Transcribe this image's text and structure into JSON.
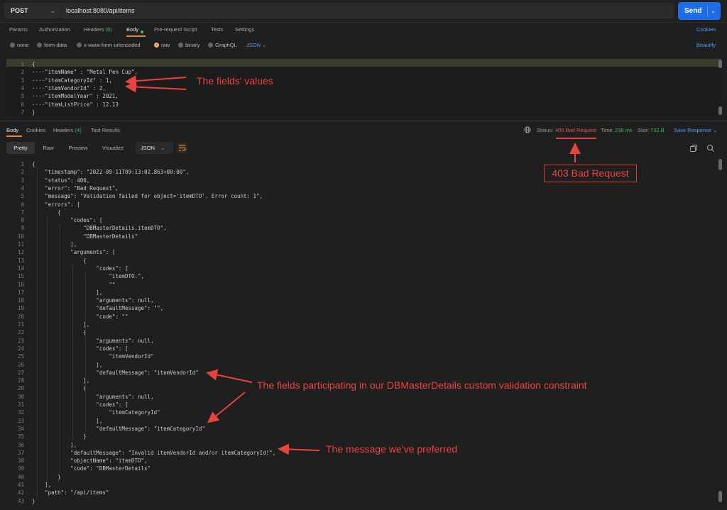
{
  "request": {
    "method": "POST",
    "url": "localhost:8080/api/items",
    "send_label": "Send"
  },
  "request_tabs": {
    "params": "Params",
    "authorization": "Authorization",
    "headers": "Headers",
    "headers_count": "(8)",
    "body": "Body",
    "prerequest": "Pre-request Script",
    "tests": "Tests",
    "settings": "Settings",
    "cookies": "Cookies"
  },
  "body_types": {
    "none": "none",
    "form_data": "form-data",
    "urlencoded": "x-www-form-urlencoded",
    "raw": "raw",
    "binary": "binary",
    "graphql": "GraphQL",
    "lang": "JSON",
    "beautify": "Beautify"
  },
  "request_body": {
    "line_numbers": [
      "1",
      "2",
      "3",
      "4",
      "5",
      "6",
      "7"
    ],
    "lines": [
      "{",
      "····\"itemName\" : \"Metal Pen Cup\",",
      "····\"itemCategoryId\" : 1,",
      "····\"itemVendorId\" : 2,",
      "····\"itemModelYear\" : 2021,",
      "····\"itemListPrice\" : 12.13",
      "}"
    ]
  },
  "response_tabs": {
    "body": "Body",
    "cookies": "Cookies",
    "headers": "Headers",
    "headers_count": "(4)",
    "test_results": "Test Results",
    "status_label": "Status:",
    "status_value": "400 Bad Request",
    "time_label": "Time:",
    "time_value": "238 ms",
    "size_label": "Size:",
    "size_value": "732 B",
    "save_response": "Save Response"
  },
  "response_toolbar": {
    "pretty": "Pretty",
    "raw": "Raw",
    "preview": "Preview",
    "visualize": "Visualize",
    "format": "JSON"
  },
  "response_body": {
    "line_numbers": [
      "1",
      "2",
      "3",
      "4",
      "5",
      "6",
      "7",
      "8",
      "9",
      "10",
      "11",
      "12",
      "13",
      "14",
      "15",
      "16",
      "17",
      "18",
      "19",
      "20",
      "21",
      "22",
      "23",
      "24",
      "25",
      "26",
      "27",
      "28",
      "29",
      "30",
      "31",
      "32",
      "33",
      "34",
      "35",
      "36",
      "37",
      "38",
      "39",
      "40",
      "41",
      "42",
      "43"
    ],
    "lines": [
      "{",
      "    \"timestamp\": \"2022-09-11T09:13:02.863+00:00\",",
      "    \"status\": 400,",
      "    \"error\": \"Bad Request\",",
      "    \"message\": \"Validation failed for object='itemDTO'. Error count: 1\",",
      "    \"errors\": [",
      "        {",
      "            \"codes\": [",
      "                \"DBMasterDetails.itemDTO\",",
      "                \"DBMasterDetails\"",
      "            ],",
      "            \"arguments\": [",
      "                {",
      "                    \"codes\": [",
      "                        \"itemDTO.\",",
      "                        \"\"",
      "                    ],",
      "                    \"arguments\": null,",
      "                    \"defaultMessage\": \"\",",
      "                    \"code\": \"\"",
      "                },",
      "                {",
      "                    \"arguments\": null,",
      "                    \"codes\": [",
      "                        \"itemVendorId\"",
      "                    ],",
      "                    \"defaultMessage\": \"itemVendorId\"",
      "                },",
      "                {",
      "                    \"arguments\": null,",
      "                    \"codes\": [",
      "                        \"itemCategoryId\"",
      "                    ],",
      "                    \"defaultMessage\": \"itemCategoryId\"",
      "                }",
      "            ],",
      "            \"defaultMessage\": \"Invalid itemVendorId and/or itemCategoryId!\",",
      "            \"objectName\": \"itemDTO\",",
      "            \"code\": \"DBMasterDetails\"",
      "        }",
      "    ],",
      "    \"path\": \"/api/items\"",
      "}"
    ]
  },
  "annotations": {
    "fields_values": "The fields' values",
    "bad_request": "403 Bad Request",
    "participating": "The fields participating in our DBMasterDetails custom validation constraint",
    "message": "The message we’ve preferred"
  },
  "colors": {
    "accent_blue": "#1d6de8",
    "annotation_red": "#e8433e",
    "status_red": "#e0574f"
  }
}
